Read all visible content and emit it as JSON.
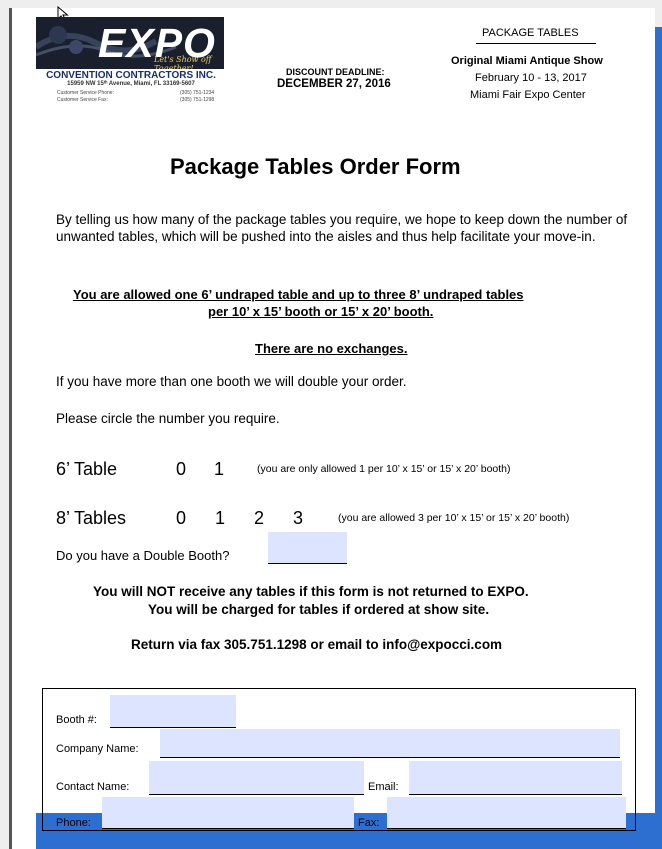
{
  "colors": {
    "accent": "#2d6fd1",
    "field_fill": "#dde4ff",
    "logo_bg": "#1a1f2e",
    "company_text": "#1a2f6a"
  },
  "icons": {
    "cursor": "pointer-arrow-icon"
  },
  "header": {
    "logo_text": "EXPO",
    "logo_tagline": "Let's Show off Together!",
    "company_name": "CONVENTION CONTRACTORS INC.",
    "company_address": "15959 NW 15ᵗʰ Avenue, Miami, FL 33169-5607",
    "service_phone_label": "Customer Service Phone:",
    "service_phone": "(305) 751-1234",
    "service_fax_label": "Customer Service Fax:",
    "service_fax": "(305) 751-1298",
    "deadline_label": "DISCOUNT DEADLINE:",
    "deadline_date": "DECEMBER 27, 2016",
    "package_heading": "PACKAGE TABLES",
    "show_name": "Original Miami Antique Show",
    "show_dates": "February 10 - 13, 2017",
    "show_venue": "Miami Fair Expo Center"
  },
  "form": {
    "title": "Package Tables Order Form",
    "intro": "By telling us how many of the package tables you require, we hope to keep down the number of unwanted tables, which will be pushed into the aisles and thus help facilitate your move-in.",
    "rule_line1": "You are allowed one 6’ undraped table and up to three 8’ undraped tables",
    "rule_line2": "per 10’ x 15’ booth or 15’ x 20’ booth.",
    "no_exchanges": "There are no exchanges.",
    "double_order_note": "If you have more than one booth we will double your order.",
    "circle_note": "Please circle the number you require.",
    "six_ft": {
      "label": "6’ Table",
      "options": [
        "0",
        "1"
      ],
      "note": "(you are only allowed 1 per 10’ x 15’  or 15’ x 20’ booth)"
    },
    "eight_ft": {
      "label": "8’ Tables",
      "options": [
        "0",
        "1",
        "2",
        "3"
      ],
      "note": "(you are allowed 3 per 10’ x 15’ or 15’ x 20’ booth)"
    },
    "double_booth_question": "Do you have a Double Booth?",
    "double_booth_value": "",
    "warning1": "You will NOT receive any tables if this form is not returned to EXPO.",
    "warning2": "You will be charged for tables if ordered at show site.",
    "return_info": "Return via fax 305.751.1298 or email to info@expocci.com"
  },
  "contact_box": {
    "booth_label": "Booth #:",
    "booth_value": "",
    "company_label": "Company Name:",
    "company_value": "",
    "contact_label": "Contact Name:",
    "contact_value": "",
    "email_label": "Email:",
    "email_value": "",
    "phone_label": "Phone:",
    "phone_value": "",
    "fax_label": "Fax:",
    "fax_value": ""
  }
}
